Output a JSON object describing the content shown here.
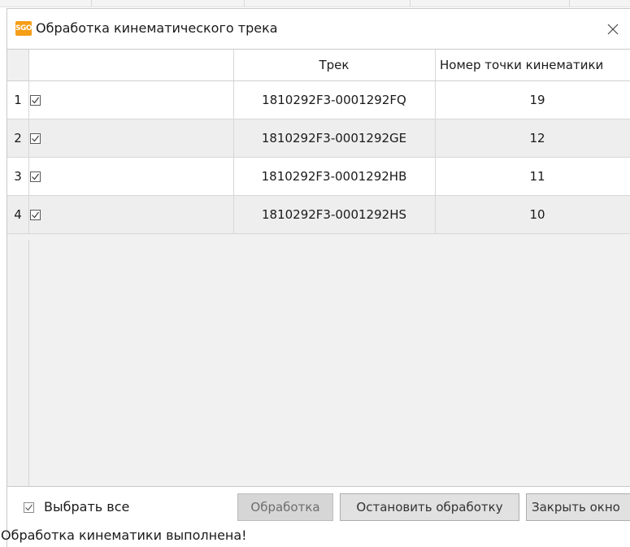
{
  "window": {
    "app_icon_text": "SGO",
    "title": "Обработка кинематического трека"
  },
  "table": {
    "columns": [
      "",
      "Трек",
      "Номер точки кинематики"
    ],
    "rows": [
      {
        "num": "1",
        "checked": true,
        "track": "1810292F3-0001292FQ",
        "point": "19"
      },
      {
        "num": "2",
        "checked": true,
        "track": "1810292F3-0001292GE",
        "point": "12"
      },
      {
        "num": "3",
        "checked": true,
        "track": "1810292F3-0001292HB",
        "point": "11"
      },
      {
        "num": "4",
        "checked": true,
        "track": "1810292F3-0001292HS",
        "point": "10"
      }
    ]
  },
  "bottom": {
    "select_all_label": "Выбрать все",
    "select_all_checked": true,
    "process_label": "Обработка",
    "stop_label": "Остановить обработку",
    "close_label": "Закрыть окно"
  },
  "status": {
    "text": "Обработка кинематики выполнена!"
  },
  "colors": {
    "app_icon": "#f59e17",
    "row_alt": "#eeeeee",
    "button_bg": "#e1e1e1"
  }
}
